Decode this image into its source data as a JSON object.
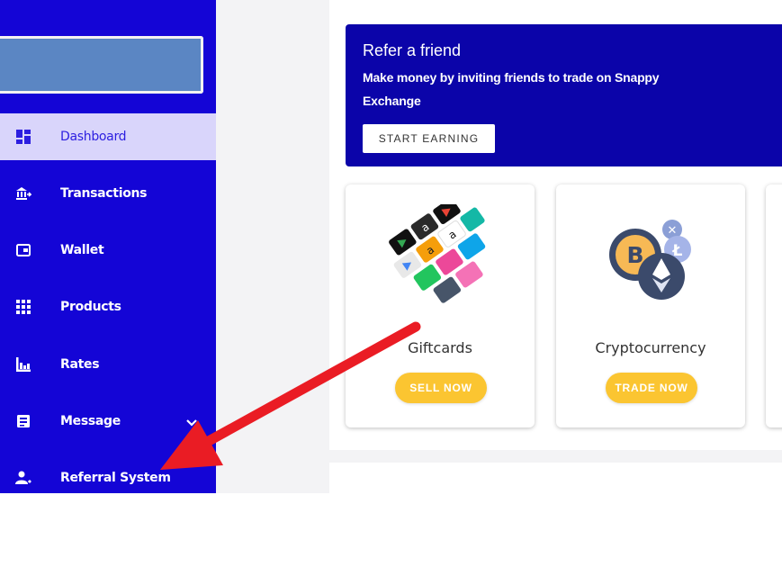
{
  "sidebar": {
    "items": [
      {
        "label": "Dashboard",
        "icon": "dashboard-icon"
      },
      {
        "label": "Transactions",
        "icon": "bank-transfer-icon"
      },
      {
        "label": "Wallet",
        "icon": "wallet-icon"
      },
      {
        "label": "Products",
        "icon": "grid-icon"
      },
      {
        "label": "Rates",
        "icon": "chart-icon"
      },
      {
        "label": "Message",
        "icon": "message-icon"
      },
      {
        "label": "Referral System",
        "icon": "user-referral-icon"
      }
    ],
    "active_item": "Dashboard"
  },
  "refer": {
    "title": "Refer a friend",
    "subtitle": "Make money by inviting friends to trade on Snappy Exchange",
    "button_label": "START EARNING"
  },
  "products": [
    {
      "title": "Giftcards",
      "button_label": "SELL NOW"
    },
    {
      "title": "Cryptocurrency",
      "button_label": "TRADE NOW"
    }
  ],
  "colors": {
    "sidebar": "#1405d6",
    "refer_banner": "#0b04a9",
    "button_yellow": "#fbc531",
    "annotation_arrow": "#ea1c24"
  }
}
